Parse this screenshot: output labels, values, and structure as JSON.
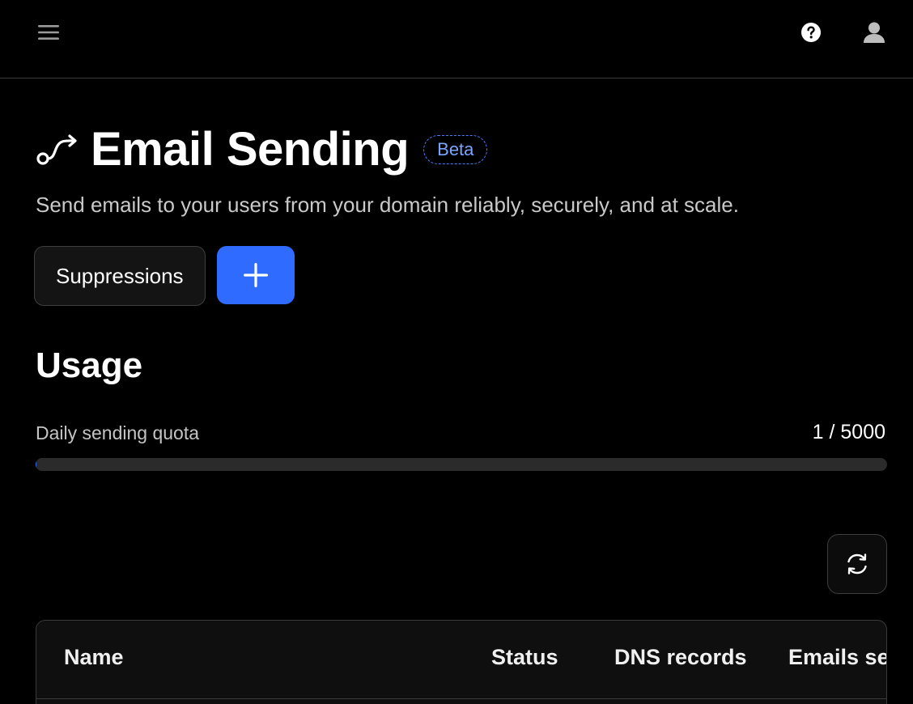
{
  "header": {
    "menu_icon": "hamburger-menu-icon",
    "help_icon": "question-circle-icon",
    "account_icon": "user-avatar-icon"
  },
  "page": {
    "icon": "route-icon",
    "title": "Email Sending",
    "badge": "Beta",
    "subtitle": "Send emails to your users from your domain reliably, securely, and at scale."
  },
  "actions": {
    "suppressions_label": "Suppressions",
    "add_icon": "plus-icon"
  },
  "usage": {
    "section_title": "Usage",
    "quota_label": "Daily sending quota",
    "quota_value": "1 / 5000",
    "quota_fraction": 0.0002
  },
  "table": {
    "refresh_icon": "refresh-icon",
    "columns": [
      "Name",
      "Status",
      "DNS records",
      "Emails sent"
    ]
  },
  "colors": {
    "background": "#000000",
    "accent": "#2f6bff",
    "badge": "#7aa4ff",
    "border": "#3a3a3a"
  }
}
